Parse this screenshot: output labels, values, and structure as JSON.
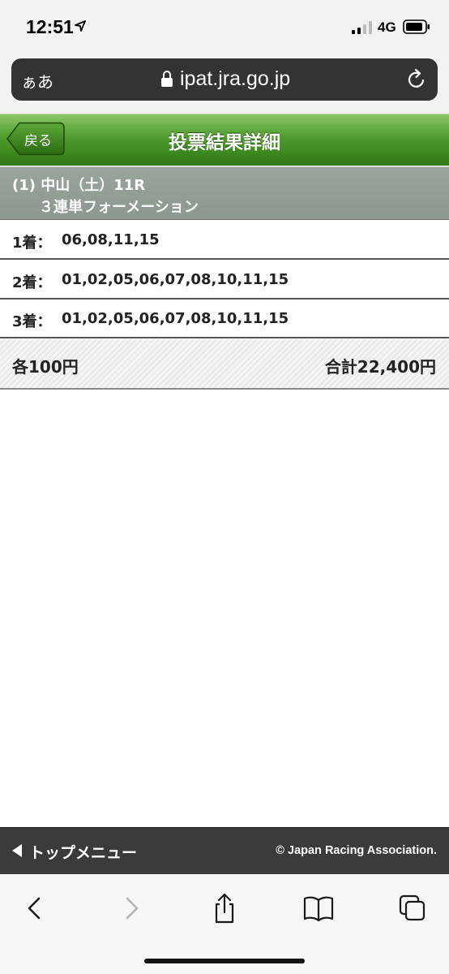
{
  "status_bar": {
    "time": "12:51",
    "network": "4G"
  },
  "browser": {
    "text_size_button": "ぁあ",
    "url": "ipat.jra.go.jp"
  },
  "header": {
    "back_label": "戻る",
    "title": "投票結果詳細"
  },
  "race": {
    "line1": "(1) 中山（土）11R",
    "line2": "３連単フォーメーション"
  },
  "results": [
    {
      "label": "1着：",
      "value": "06,08,11,15"
    },
    {
      "label": "2着：",
      "value": "01,02,05,06,07,08,10,11,15"
    },
    {
      "label": "3着：",
      "value": "01,02,05,06,07,08,10,11,15"
    }
  ],
  "totals": {
    "unit_price": "各100円",
    "total_price": "合計22,400円"
  },
  "footer": {
    "top_menu_label": "トップメニュー",
    "copyright": "© Japan Racing Association."
  },
  "colors": {
    "header_green": "#4f9a2c",
    "race_band_gray": "#929d94",
    "footer_dark": "#3b3b3b",
    "toolbar_blue": "#007aff"
  }
}
